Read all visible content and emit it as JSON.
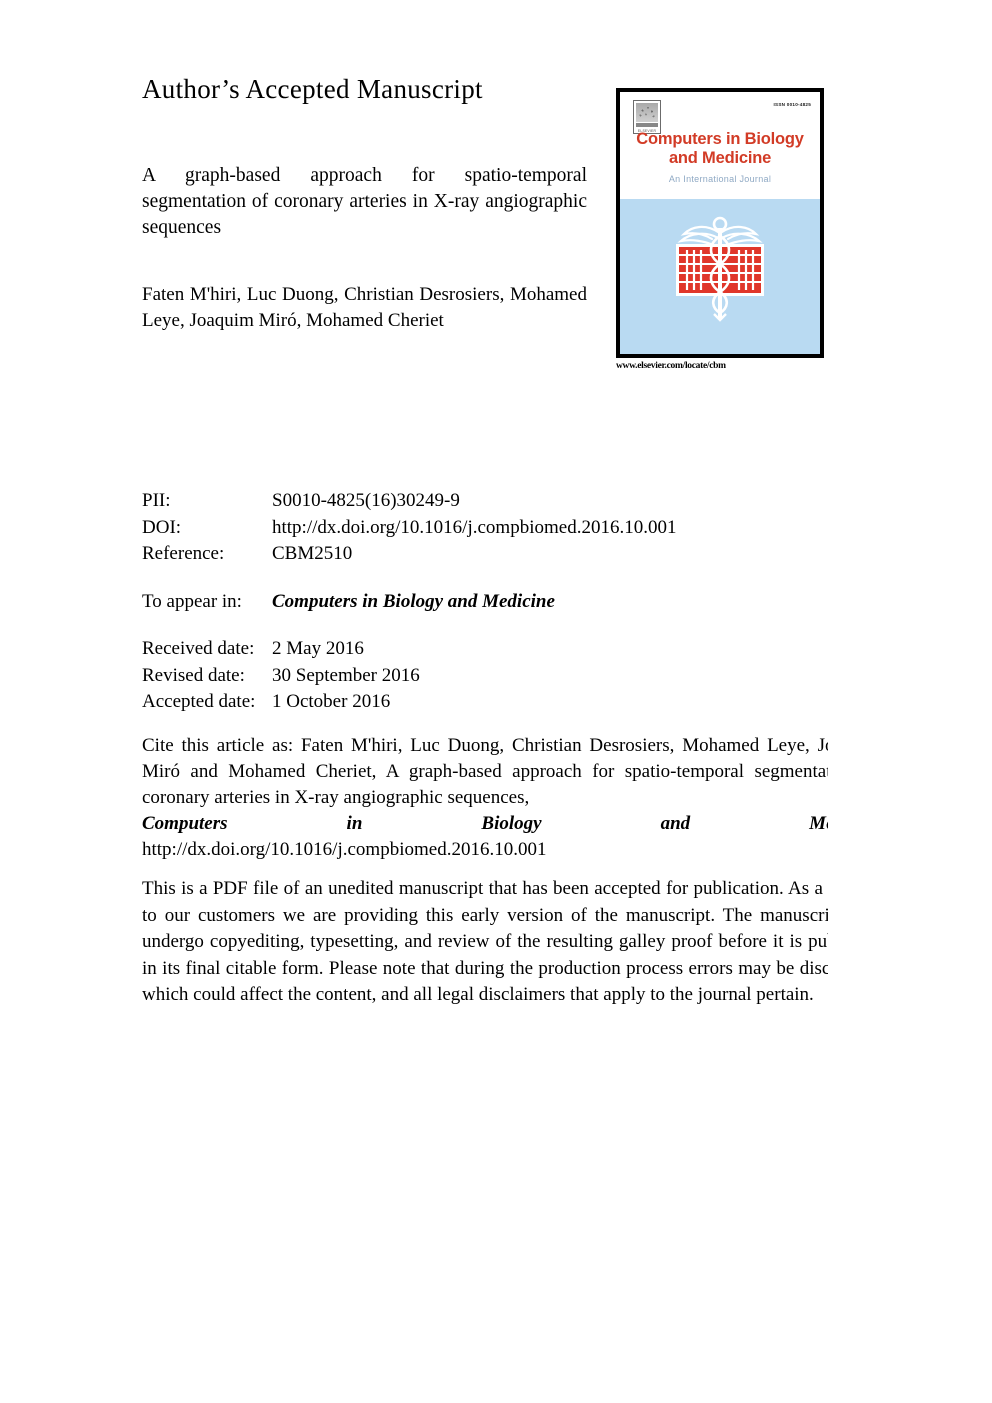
{
  "header": {
    "label": "Author’s Accepted Manuscript"
  },
  "article": {
    "title": "A graph-based approach for spatio-temporal segmentation of coronary arteries in X-ray angiographic sequences",
    "authors": "Faten M'hiri, Luc Duong, Christian Desrosiers, Mohamed Leye, Joaquim Miró, Mohamed Cheriet"
  },
  "cover": {
    "issn": "ISSN 0010-4825",
    "title_line1": "Computers in Biology",
    "title_line2": "and Medicine",
    "subtitle": "An International Journal",
    "url": "www.elsevier.com/locate/cbm",
    "publisher": "ELSEVIER",
    "title_color": "#d23b26",
    "subtitle_color": "#8fa9c4",
    "panel_color": "#b9daf2",
    "abacus_color": "#e0362a"
  },
  "metadata": {
    "rows": [
      {
        "label": "PII:",
        "value": "S0010-4825(16)30249-9"
      },
      {
        "label": "DOI:",
        "value": "http://dx.doi.org/10.1016/j.compbiomed.2016.10.001"
      },
      {
        "label": "Reference:",
        "value": "CBM2510"
      }
    ],
    "appear_label": "To appear in:",
    "appear_value": "Computers in Biology and Medicine",
    "dates": [
      {
        "label": "Received date:",
        "value": "2 May 2016"
      },
      {
        "label": "Revised date:",
        "value": "30 September 2016"
      },
      {
        "label": "Accepted date:",
        "value": "1 October 2016"
      }
    ]
  },
  "citation": {
    "lead": "Cite this article as: Faten M'hiri, Luc Duong, Christian Desrosiers, Mohamed Leye, Joaquim Miró and Mohamed Cheriet, A graph-based approach for spatio-temporal segmentation of coronary arteries in X-ray angiographic sequences,",
    "journal": "Computers in Biology and Medicine",
    "doi": "http://dx.doi.org/10.1016/j.compbiomed.2016.10.001"
  },
  "disclaimer": {
    "text": "This is a PDF file of an unedited manuscript that has been accepted for publication. As a service to our customers we are providing this early version of the manuscript. The manuscript will undergo copyediting, typesetting, and review of the resulting galley proof before it is published in its final citable form. Please note that during the production process errors may be discovered which could affect the content, and all legal disclaimers that apply to the journal pertain."
  }
}
